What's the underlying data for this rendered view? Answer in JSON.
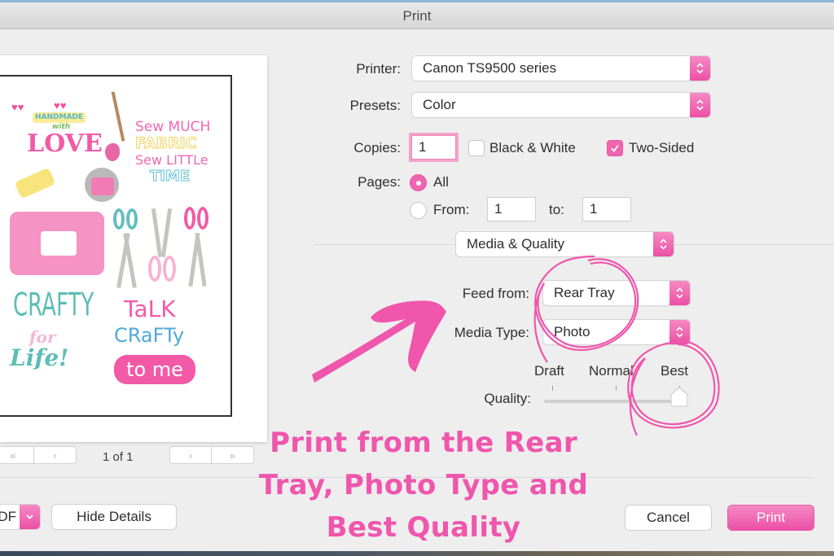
{
  "window": {
    "title": "Print"
  },
  "colors": {
    "accent": "#ef56ac",
    "accent_light": "#f58ac3",
    "window_bg": "#eeeeee"
  },
  "preview": {
    "art_texts": {
      "handmade": "HANDMADE",
      "with": "with",
      "love": "LOVE",
      "sew_much": "Sew MUCH",
      "fabric": "FABRIC",
      "sew_little": "Sew LITTLe",
      "time": "TIME",
      "crafty": "CRAFTY",
      "for": "for",
      "life": "Life!",
      "talk": "TaLK",
      "crafty2": "CRaFTy",
      "to_me": "to me"
    },
    "page_indicator": "1 of 1",
    "first_page_icon": "«",
    "prev_page_icon": "‹",
    "next_page_icon": "›",
    "last_page_icon": "»"
  },
  "form": {
    "printer": {
      "label": "Printer:",
      "value": "Canon TS9500 series"
    },
    "presets": {
      "label": "Presets:",
      "value": "Color"
    },
    "copies": {
      "label": "Copies:",
      "value": "1"
    },
    "black_white": {
      "label": "Black & White",
      "checked": false
    },
    "two_sided": {
      "label": "Two-Sided",
      "checked": true
    },
    "pages": {
      "label": "Pages:",
      "all_label": "All",
      "all_selected": true,
      "from_label": "From:",
      "from_value": "1",
      "to_label": "to:",
      "to_value": "1"
    },
    "section": {
      "value": "Media & Quality"
    },
    "feed_from": {
      "label": "Feed from:",
      "value": "Rear Tray"
    },
    "media_type": {
      "label": "Media Type:",
      "value": "Photo"
    },
    "quality": {
      "label": "Quality:",
      "ticks": [
        "Draft",
        "Normal",
        "Best"
      ],
      "selected": "Best",
      "position_fraction": 1.0
    }
  },
  "footer": {
    "pdf_label": "PDF",
    "hide_details": "Hide Details",
    "cancel": "Cancel",
    "print": "Print"
  },
  "annotation": {
    "line1": "Print from the Rear",
    "line2": "Tray, Photo Type and",
    "line3": "Best Quality"
  }
}
